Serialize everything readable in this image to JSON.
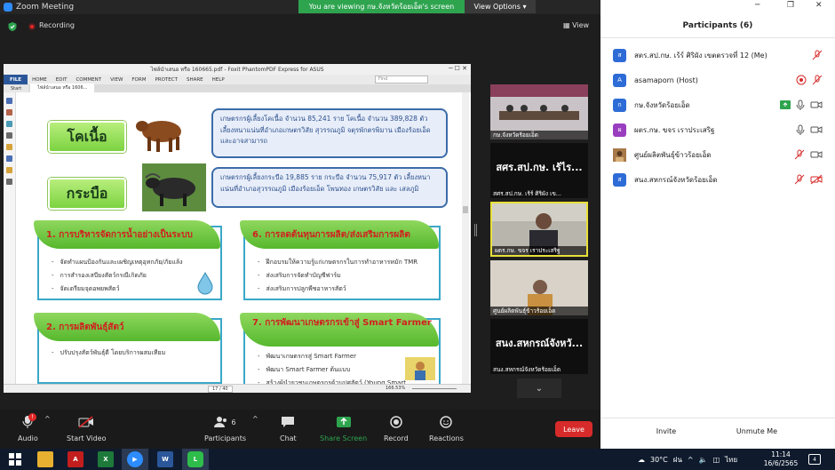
{
  "window": {
    "title": "Zoom Meeting",
    "viewing_banner": "You are viewing กษ.จังหวัดร้อยเอ็ด's screen",
    "view_options": "View Options",
    "recording": "Recording",
    "view": "View"
  },
  "pdf": {
    "title": "ไฟล์นำเสนอ หรือ 160665.pdf - Foxit PhantomPDF Express for ASUS",
    "ribbon": [
      "FILE",
      "HOME",
      "EDIT",
      "COMMENT",
      "VIEW",
      "FORM",
      "PROTECT",
      "SHARE",
      "HELP"
    ],
    "find_placeholder": "Find",
    "tabs": [
      "Start",
      "ไฟล์นำเสนอ หรือ 1606..."
    ],
    "page": "17 / 40",
    "zoom": "166.53%"
  },
  "slide": {
    "cattle_label": "โคเนื้อ",
    "cattle_info": "เกษตรกรผู้เลี้ยงโคเนื้อ จำนวน 85,241 ราย โคเนื้อ จำนวน 389,828 ตัว เลี้ยงหนาแน่นที่อำเภอเกษตรวิสัย สุวรรณภูมิ จตุรพักตรพิมาน เมืองร้อยเอ็ด และอาจสามารถ",
    "buffalo_label": "กระบือ",
    "buffalo_info": "เกษตรกรผู้เลี้ยงกระบือ 19,885 ราย กระบือ จำนวน 75,917 ตัว เลี้ยงหนาแน่นที่อำเภอสุวรรณภูมิ เมืองร้อยเอ็ด โพนทอง เกษตรวิสัย และ เสลภูมิ",
    "card1": {
      "title": "1. การบริหารจัดการน้ำอย่างเป็นระบบ",
      "items": [
        "จัดทำแผนป้องกันและเผชิญเหตุอุทกภัย/ภัยแล้ง",
        "การสำรองเสบียงสัตว์กรณีเกิดภัย",
        "จัดเตรียมจุดอพยพสัตว์"
      ]
    },
    "card6": {
      "title": "6. การลดต้นทุนการผลิต/ส่งเสริมการผลิต",
      "items": [
        "ฝึกอบรมให้ความรู้แก่เกษตรกรในการทำอาหารหมัก TMR",
        "ส่งเสริมการจัดทำบัญชีฟาร์ม",
        "ส่งเสริมการปลูกพืชอาหารสัตว์"
      ]
    },
    "card2": {
      "title": "2. การผลิตพันธุ์สัตว์",
      "items": [
        "ปรับปรุงสัตว์พันธุ์ดี โดยบริการผสมเทียม"
      ]
    },
    "card7": {
      "title": "7. การพัฒนาเกษตรกรเข้าสู่ Smart Farmer",
      "items": [
        "พัฒนาเกษตรกรสู่ Smart Farmer",
        "พัฒนา Smart Farmer ต้นแบบ",
        "สร้างผู้นำยุวชนเกษตรกรด้านปศุสัตว์ (Young Smart"
      ]
    }
  },
  "tiles": [
    {
      "name": "กษ.จังหวัดร้อยเอ็ด"
    },
    {
      "big": "สศร.สป.กษ. เร้ไร...",
      "name": "สศร.สป.กษ. เร้ร์ ศิริผัง เข..."
    },
    {
      "name": "ผตร.กษ. ขจร เราประเสริฐ"
    },
    {
      "name": "ศูนย์ผลิตพันธุ์ข้าวร้อยเอ็ด"
    },
    {
      "big": "สนง.สหกรณ์จังหวั...",
      "name": "สนง.สหกรณ์จังหวัดร้อยเอ็ด"
    }
  ],
  "toolbar": {
    "audio": "Audio",
    "start_video": "Start Video",
    "participants": "Participants",
    "participants_count": "6",
    "chat": "Chat",
    "share_screen": "Share Screen",
    "record": "Record",
    "reactions": "Reactions",
    "leave": "Leave",
    "audio_badge": "!"
  },
  "participants": {
    "title": "Participants (6)",
    "list": [
      {
        "initial": "ส",
        "name": "สตร.สป.กษ. เร้ร์ ศิริผัง เขตตรวจที่ 12 (Me)",
        "color": "#2d6bd6"
      },
      {
        "initial": "A",
        "name": "asamaporn (Host)",
        "color": "#2d6bd6"
      },
      {
        "initial": "ก",
        "name": "กษ.จังหวัดร้อยเอ็ด",
        "color": "#2d6bd6"
      },
      {
        "initial": "ผ",
        "name": "ผตร.กษ. ขจร เราประเสริฐ",
        "color": "#9a3ec0"
      },
      {
        "initial": "",
        "name": "ศูนย์ผลิตพันธุ์ข้าวร้อยเอ็ด",
        "color": "#8a5a2b"
      },
      {
        "initial": "ส",
        "name": "สนง.สหกรณ์จังหวัดร้อยเอ็ด",
        "color": "#2d6bd6"
      }
    ],
    "invite": "Invite",
    "unmute_me": "Unmute Me"
  },
  "taskbar": {
    "temperature": "30°C",
    "weather": "ฝน",
    "lang": "ไทย",
    "time": "11:14",
    "date": "16/6/2565",
    "notifications": "4"
  },
  "colors": {
    "zoom_green": "#2ea44f",
    "leave_red": "#d72a2a",
    "accent_blue": "#2d6bd6"
  }
}
